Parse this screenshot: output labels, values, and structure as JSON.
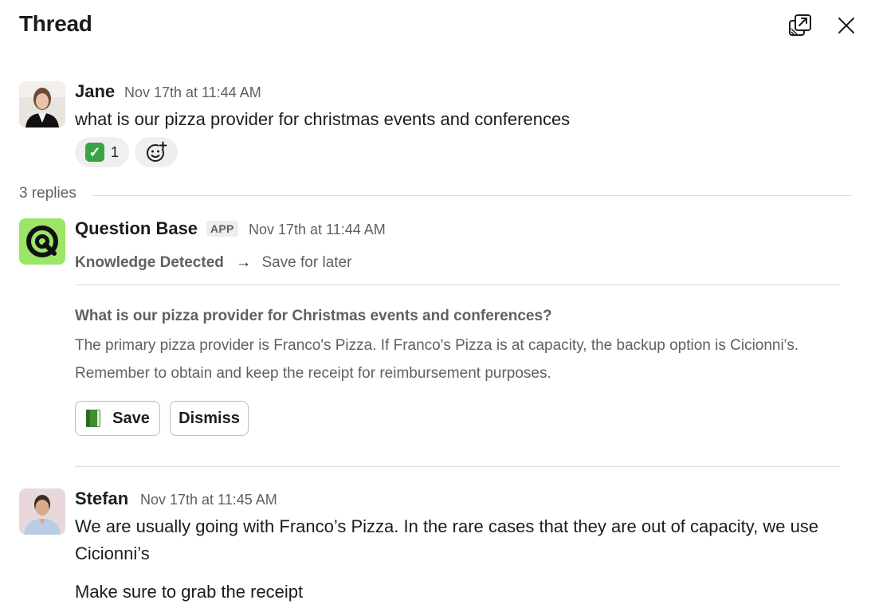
{
  "header": {
    "title": "Thread",
    "open_window_icon": "open-in-new-window-icon",
    "close_icon": "close-icon"
  },
  "messages": [
    {
      "sender": "Jane",
      "timestamp": "Nov 17th at 11:44 AM",
      "text": "what is our pizza provider for christmas events and conferences",
      "reactions": [
        {
          "emoji": "✓",
          "emoji_name": "white-check-mark",
          "count": "1"
        }
      ],
      "add_reaction_icon": "add-reaction-icon"
    }
  ],
  "replies": {
    "label": "3 replies"
  },
  "app_message": {
    "sender": "Question Base",
    "badge": "APP",
    "timestamp": "Nov 17th at 11:44 AM",
    "status": "Knowledge Detected",
    "arrow": "→",
    "action": "Save for later",
    "question": "What is our pizza provider for Christmas events and conferences?",
    "answer": "The primary pizza provider is Franco's Pizza. If Franco's Pizza is at capacity, the backup option is Cicionni's. Remember to obtain and keep the receipt for reimbursement purposes.",
    "save_label": "Save",
    "dismiss_label": "Dismiss",
    "accent": "#9be567"
  },
  "reply_message": {
    "sender": "Stefan",
    "timestamp": "Nov 17th at 11:45 AM",
    "text_1": "We are usually going with Franco’s Pizza. In the rare cases that they are out of capacity, we use Cicionni’s",
    "text_2": "Make sure to grab the receipt"
  }
}
